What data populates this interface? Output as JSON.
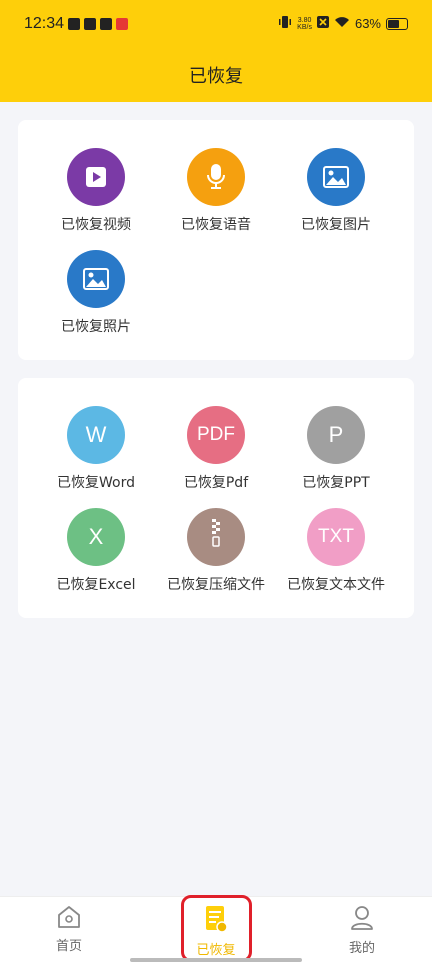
{
  "status_bar": {
    "time": "12:34",
    "net_speed_value": "3.80",
    "net_speed_unit": "KB/s",
    "battery": "63%"
  },
  "header": {
    "title": "已恢复"
  },
  "media_section": {
    "items": [
      {
        "label": "已恢复视频",
        "icon": "video-play-icon",
        "color": "#7b3aa6"
      },
      {
        "label": "已恢复语音",
        "icon": "microphone-icon",
        "color": "#f5a00f"
      },
      {
        "label": "已恢复图片",
        "icon": "image-icon",
        "color": "#2979c8"
      },
      {
        "label": "已恢复照片",
        "icon": "photo-icon",
        "color": "#2979c8"
      }
    ]
  },
  "document_section": {
    "items": [
      {
        "label": "已恢复Word",
        "glyph": "W",
        "icon": "word-icon",
        "color": "#5cb8e4"
      },
      {
        "label": "已恢复Pdf",
        "glyph": "PDF",
        "icon": "pdf-icon",
        "color": "#e66e83"
      },
      {
        "label": "已恢复PPT",
        "glyph": "P",
        "icon": "ppt-icon",
        "color": "#a0a0a0"
      },
      {
        "label": "已恢复Excel",
        "glyph": "X",
        "icon": "excel-icon",
        "color": "#6dc084"
      },
      {
        "label": "已恢复压缩文件",
        "glyph": "",
        "icon": "zip-icon",
        "color": "#a88c82"
      },
      {
        "label": "已恢复文本文件",
        "glyph": "TXT",
        "icon": "txt-icon",
        "color": "#f19ec6"
      }
    ]
  },
  "bottom_nav": {
    "tabs": [
      {
        "label": "首页",
        "icon": "home-icon"
      },
      {
        "label": "已恢复",
        "icon": "recovered-doc-icon",
        "active": true
      },
      {
        "label": "我的",
        "icon": "user-icon"
      }
    ],
    "active_color": "#f0b800"
  },
  "colors": {
    "accent": "#fecf0a",
    "highlight_frame": "#e0202a"
  }
}
